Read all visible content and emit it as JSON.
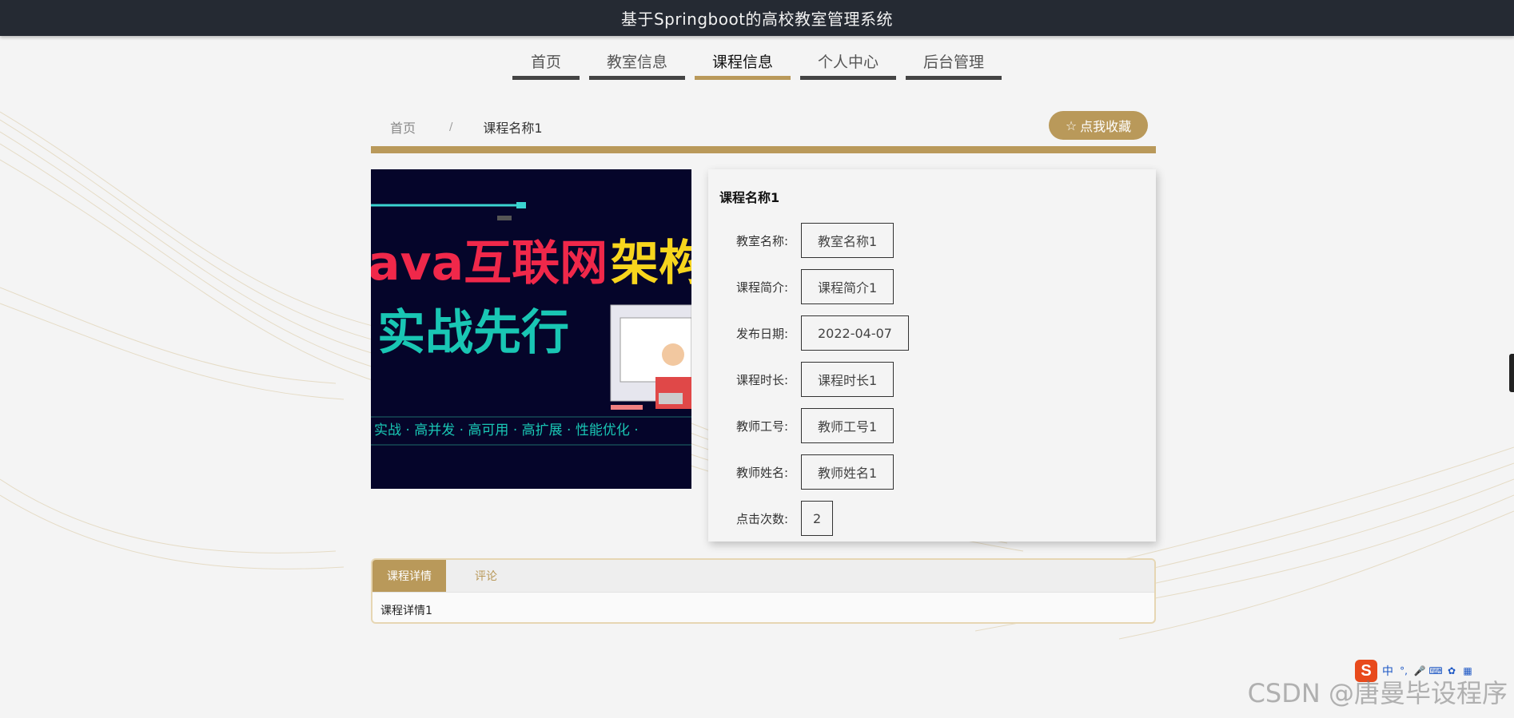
{
  "header": {
    "title": "基于Springboot的高校教室管理系统"
  },
  "nav": {
    "items": [
      {
        "label": "首页",
        "active": false
      },
      {
        "label": "教室信息",
        "active": false
      },
      {
        "label": "课程信息",
        "active": true
      },
      {
        "label": "个人中心",
        "active": false
      },
      {
        "label": "后台管理",
        "active": false
      }
    ]
  },
  "breadcrumb": {
    "home": "首页",
    "separator": "/",
    "current": "课程名称1"
  },
  "favorite": {
    "icon": "star-outline-icon",
    "label": "点我收藏"
  },
  "poster": {
    "line1": "ava互联网架构",
    "line1_white": "ava互联网",
    "line1_yellow": "架构",
    "line2": "实战先行",
    "line3": "实战 · 高并发 · 高可用 · 高扩展 · 性能优化 ·"
  },
  "detail": {
    "title": "课程名称1",
    "fields": [
      {
        "label": "教室名称:",
        "value": "教室名称1"
      },
      {
        "label": "课程简介:",
        "value": "课程简介1"
      },
      {
        "label": "发布日期:",
        "value": "2022-04-07"
      },
      {
        "label": "课程时长:",
        "value": "课程时长1"
      },
      {
        "label": "教师工号:",
        "value": "教师工号1"
      },
      {
        "label": "教师姓名:",
        "value": "教师姓名1"
      },
      {
        "label": "点击次数:",
        "value": "2"
      }
    ]
  },
  "tabs": {
    "items": [
      {
        "label": "课程详情",
        "active": true
      },
      {
        "label": "评论",
        "active": false
      }
    ],
    "content": "课程详情1"
  },
  "tray": {
    "ime_label": "中"
  },
  "watermark": "CSDN @唐曼毕设程序",
  "colors": {
    "accent": "#b9995a",
    "topbar": "#252a33",
    "background": "#f4f4f4"
  }
}
